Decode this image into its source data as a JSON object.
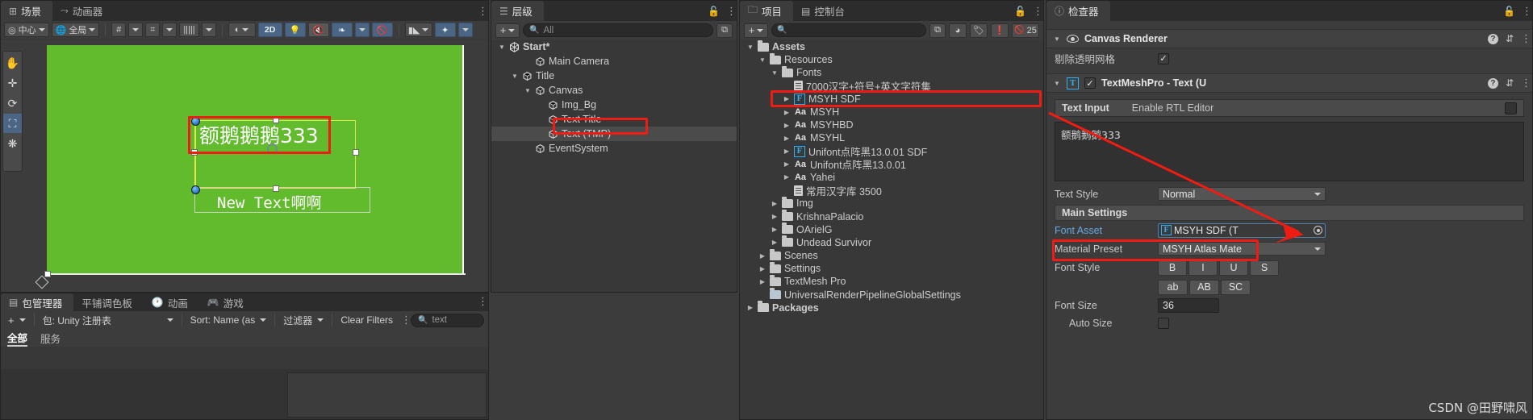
{
  "scene": {
    "tabs": [
      {
        "label": "场景",
        "icon": "scene-icon",
        "active": true
      },
      {
        "label": "动画器",
        "icon": "animator-icon",
        "active": false
      }
    ],
    "toolbar": {
      "pivot": "中心",
      "space": "全局",
      "two_d": "2D",
      "icons": [
        "pivot-icon",
        "globe-icon",
        "grid-snap-icon",
        "magnet-snap-icon",
        "ruler-snap-icon",
        "shading-mode-icon",
        "2d-toggle",
        "light-toggle",
        "audio-toggle",
        "fx-toggle",
        "fx-dropdown",
        "visibility-toggle",
        "camera-icon",
        "gizmos-icon"
      ]
    },
    "left_tools": [
      "hand-tool",
      "move-tool",
      "rotate-tool",
      "rect-tool",
      "transform-tool"
    ],
    "canvas_text_selected": "额鹅鹅鹅333",
    "canvas_text_second": "New Text啊啊",
    "background_color": "#62bb2c"
  },
  "hierarchy": {
    "tab": "层级",
    "add_label": "+",
    "search_placeholder": "All",
    "items": [
      {
        "label": "Start*",
        "depth": 0,
        "arrow": "▼",
        "icon": "unity-scene-icon",
        "bold": true,
        "selected": false
      },
      {
        "label": "Main Camera",
        "depth": 2,
        "arrow": "",
        "icon": "gameobject-icon",
        "bold": false,
        "selected": false
      },
      {
        "label": "Title",
        "depth": 1,
        "arrow": "▼",
        "icon": "gameobject-icon",
        "bold": false,
        "selected": false
      },
      {
        "label": "Canvas",
        "depth": 2,
        "arrow": "▼",
        "icon": "gameobject-icon",
        "bold": false,
        "selected": false
      },
      {
        "label": "Img_Bg",
        "depth": 3,
        "arrow": "",
        "icon": "gameobject-icon",
        "bold": false,
        "selected": false
      },
      {
        "label": "Text Title",
        "depth": 3,
        "arrow": "",
        "icon": "gameobject-icon",
        "bold": false,
        "selected": false
      },
      {
        "label": "Text (TMP)",
        "depth": 3,
        "arrow": "",
        "icon": "gameobject-icon",
        "bold": false,
        "selected": true
      },
      {
        "label": "EventSystem",
        "depth": 2,
        "arrow": "",
        "icon": "gameobject-icon",
        "bold": false,
        "selected": false
      }
    ]
  },
  "project": {
    "tabs": [
      {
        "label": "项目",
        "icon": "folder-icon",
        "active": true
      },
      {
        "label": "控制台",
        "icon": "console-icon",
        "active": false
      }
    ],
    "add_label": "+",
    "search_placeholder": "",
    "badge_count": "25",
    "items": [
      {
        "label": "Assets",
        "depth": 0,
        "arrow": "▼",
        "icon": "folder",
        "bold": true
      },
      {
        "label": "Resources",
        "depth": 1,
        "arrow": "▼",
        "icon": "folder",
        "bold": false
      },
      {
        "label": "Fonts",
        "depth": 2,
        "arrow": "▼",
        "icon": "folder",
        "bold": false
      },
      {
        "label": "7000汉字+符号+英文字符集",
        "depth": 3,
        "arrow": "",
        "icon": "doc",
        "bold": false
      },
      {
        "label": "MSYH SDF",
        "depth": 3,
        "arrow": "▶",
        "icon": "fontasset",
        "bold": false,
        "highlight": true
      },
      {
        "label": "MSYH",
        "depth": 3,
        "arrow": "▶",
        "icon": "font",
        "bold": false
      },
      {
        "label": "MSYHBD",
        "depth": 3,
        "arrow": "▶",
        "icon": "font",
        "bold": false
      },
      {
        "label": "MSYHL",
        "depth": 3,
        "arrow": "▶",
        "icon": "font",
        "bold": false
      },
      {
        "label": "Unifont点阵黑13.0.01 SDF",
        "depth": 3,
        "arrow": "▶",
        "icon": "fontasset",
        "bold": false
      },
      {
        "label": "Unifont点阵黑13.0.01",
        "depth": 3,
        "arrow": "▶",
        "icon": "font",
        "bold": false
      },
      {
        "label": "Yahei",
        "depth": 3,
        "arrow": "▶",
        "icon": "font",
        "bold": false
      },
      {
        "label": "常用汉字库 3500",
        "depth": 3,
        "arrow": "",
        "icon": "doc",
        "bold": false
      },
      {
        "label": "Img",
        "depth": 2,
        "arrow": "▶",
        "icon": "folder",
        "bold": false
      },
      {
        "label": "KrishnaPalacio",
        "depth": 2,
        "arrow": "▶",
        "icon": "folder",
        "bold": false
      },
      {
        "label": "OArielG",
        "depth": 2,
        "arrow": "▶",
        "icon": "folder",
        "bold": false
      },
      {
        "label": "Undead Survivor",
        "depth": 2,
        "arrow": "▶",
        "icon": "folder",
        "bold": false
      },
      {
        "label": "Scenes",
        "depth": 1,
        "arrow": "▶",
        "icon": "folder",
        "bold": false
      },
      {
        "label": "Settings",
        "depth": 1,
        "arrow": "▶",
        "icon": "folder",
        "bold": false
      },
      {
        "label": "TextMesh Pro",
        "depth": 1,
        "arrow": "▶",
        "icon": "folder",
        "bold": false
      },
      {
        "label": "UniversalRenderPipelineGlobalSettings",
        "depth": 1,
        "arrow": "",
        "icon": "settings-asset",
        "bold": false
      },
      {
        "label": "Packages",
        "depth": 0,
        "arrow": "▶",
        "icon": "folder",
        "bold": true
      }
    ]
  },
  "inspector": {
    "tab": "检查器",
    "canvas_renderer": {
      "title": "Canvas Renderer",
      "cull_label": "剔除透明网格",
      "cull_checked": "✓"
    },
    "tmp": {
      "title": "TextMeshPro - Text (U",
      "enabled_mark": "✓",
      "text_input_label": "Text Input",
      "rtl_label": "Enable RTL Editor",
      "text_value": "额鹅鹅鹅333",
      "text_style_label": "Text Style",
      "text_style_value": "Normal",
      "main_settings_label": "Main Settings",
      "font_asset_label": "Font Asset",
      "font_asset_value": "MSYH SDF (T",
      "material_preset_label": "Material Preset",
      "material_preset_value": "MSYH Atlas Mate",
      "font_style_label": "Font Style",
      "font_style_buttons": [
        "B",
        "I",
        "U",
        "S"
      ],
      "font_case_buttons": [
        "ab",
        "AB",
        "SC"
      ],
      "font_size_label": "Font Size",
      "font_size_value": "36",
      "auto_size_label": "Auto Size"
    },
    "watermark": "CSDN @田野啸风"
  },
  "package_manager": {
    "tabs": [
      {
        "label": "包管理器",
        "icon": "package-icon",
        "active": true
      },
      {
        "label": "平铺调色板",
        "icon": "",
        "active": false
      },
      {
        "label": "动画",
        "icon": "clock-icon",
        "active": false
      },
      {
        "label": "游戏",
        "icon": "gamepad-icon",
        "active": false
      }
    ],
    "scope_label": "包: Unity 注册表",
    "sort_label": "Sort: Name (as",
    "filter_label": "过滤器",
    "clear_filters_label": "Clear Filters",
    "search_value": "text",
    "subtabs": [
      {
        "label": "全部",
        "active": true
      },
      {
        "label": "服务",
        "active": false
      }
    ]
  },
  "annotation": {
    "accent_red": "#ee1c12"
  }
}
